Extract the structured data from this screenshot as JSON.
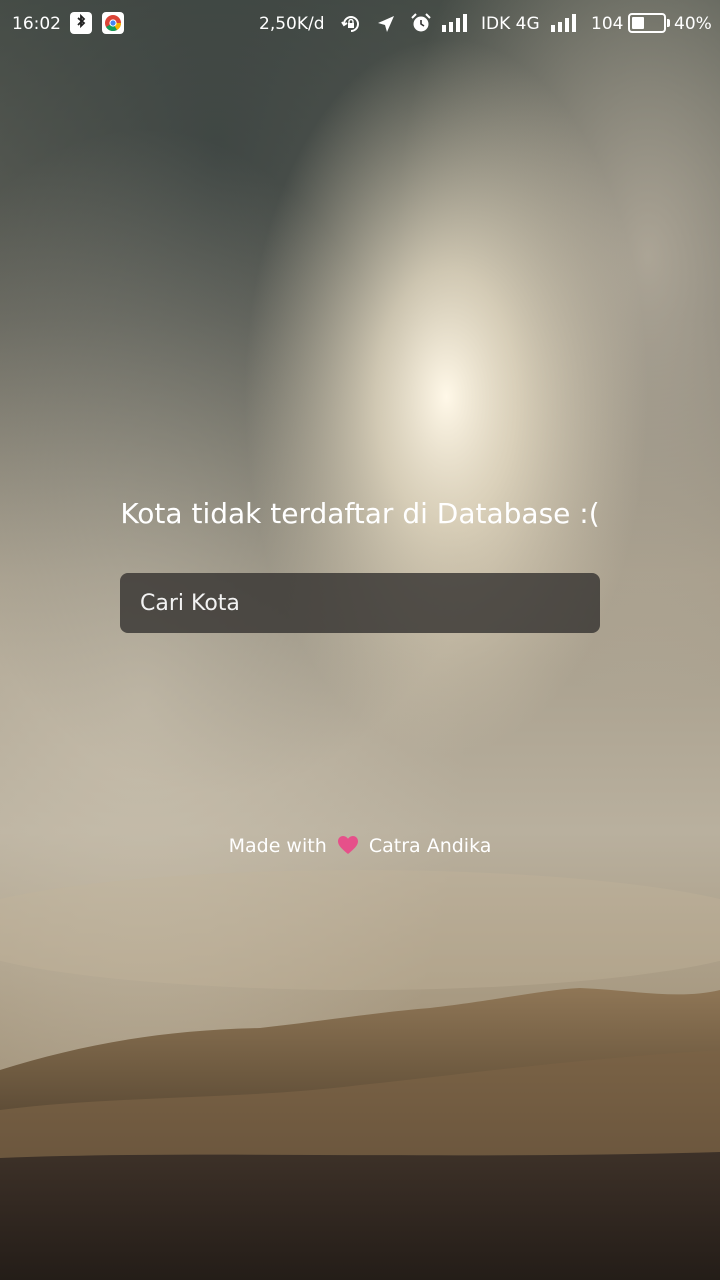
{
  "status_bar": {
    "time": "16:02",
    "app_icons": [
      "bluetooth-app-icon",
      "chrome-icon"
    ],
    "network_speed": "2,50K/d",
    "icons": [
      "rotation-lock-icon",
      "location-icon",
      "alarm-icon",
      "signal-icon"
    ],
    "carrier": "IDK 4G",
    "signal_value": "104",
    "battery_percent": "40%",
    "battery_level": 0.4
  },
  "main": {
    "message": "Kota tidak terdaftar di Database :(",
    "search_placeholder": "Cari Kota"
  },
  "footer": {
    "made_with": "Made with",
    "heart_icon": "heart-icon",
    "heart_color": "#e6508a",
    "author": "Catra Andika"
  }
}
